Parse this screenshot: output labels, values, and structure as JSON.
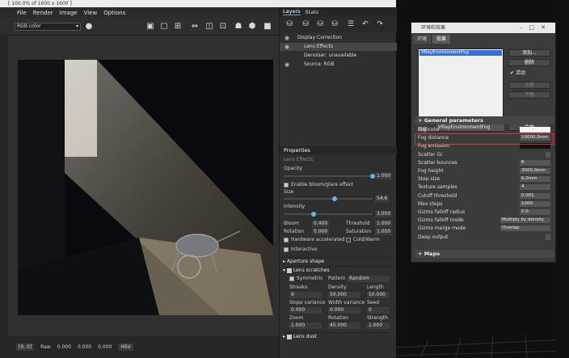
{
  "vfb": {
    "title": "[ 100.0% of 1600 x 1600 ]",
    "menu": [
      "File",
      "Render",
      "Image",
      "View",
      "Options"
    ],
    "channel_select": "RGB color",
    "status": {
      "coords": "[0, 0]",
      "fmt": "Raw",
      "values": [
        "0.000",
        "0.000",
        "0.000"
      ],
      "hsv": "HSV"
    }
  },
  "layers": {
    "tabs": [
      "Layers",
      "Stats"
    ],
    "tree": [
      {
        "label": "Display Correction",
        "indent": 0
      },
      {
        "label": "Lens Effects",
        "indent": 1,
        "selected": true
      },
      {
        "label": "Denoiser: unavailable",
        "indent": 1
      },
      {
        "label": "Source: RGB",
        "indent": 1
      }
    ]
  },
  "properties": {
    "header": "Properties",
    "subheader": "Lens Effects",
    "opacity_label": "Opacity",
    "opacity_value": "1.000",
    "enable_bloom_label": "Enable bloom/glare effect",
    "size_label": "Size",
    "size_value": "54.6",
    "intensity_label": "Intensity",
    "intensity_value": "3.000",
    "bloom_label": "Bloom",
    "bloom_value": "0.400",
    "threshold_label": "Threshold",
    "threshold_value": "1.000",
    "rotation_label": "Rotation",
    "rotation_value": "0.000",
    "saturation_label": "Saturation",
    "saturation_value": "1.000",
    "hw_accel_label": "Hardware accelerated",
    "coldwarm_label": "Cold/Warm",
    "interactive_label": "Interactive",
    "aperture_label": "Aperture shape",
    "lens_scratches_label": "Lens scratches",
    "symmetric_label": "Symmetric",
    "pattern_label": "Pattern",
    "pattern_value": "Random",
    "streaks_label": "Streaks",
    "streaks_value": "9",
    "density_label": "Density",
    "density_value": "50.000",
    "length_label": "Length",
    "length_value": "50.000",
    "slope_var_label": "Slope variance",
    "slope_var_value": "0.000",
    "width_var_label": "Width variance",
    "width_var_value": "0.000",
    "seed_label": "Seed",
    "seed_value": "0",
    "zoom_label": "Zoom",
    "zoom_value": "1.000",
    "rotation2_label": "Rotation",
    "rotation2_value": "45.000",
    "strength_label": "Strength",
    "strength_value": "1.000",
    "lens_dust_label": "Lens dust"
  },
  "env_dialog": {
    "title": "环境和效果",
    "tabs": [
      "环境",
      "效果"
    ],
    "atmo_items": [
      "VRayEnvironmentFog"
    ],
    "buttons": {
      "add": "添加...",
      "delete": "删除",
      "moveup": "上移",
      "movedown": "下移",
      "merge": "合并"
    },
    "active_label": "活动",
    "name_label": "名称:",
    "name_value": "VRayEnvironmentFog",
    "general_rollout": "General parameters",
    "maps_rollout": "Maps",
    "params": [
      {
        "label": "Fog color",
        "value": "",
        "swatch": "white"
      },
      {
        "label": "Fog distance",
        "value": "10000.0mm",
        "highlight": true
      },
      {
        "label": "Fog emission",
        "value": "",
        "swatch": "black"
      },
      {
        "label": "Scatter GI",
        "value": ""
      },
      {
        "label": "Scatter bounces",
        "value": "8"
      },
      {
        "label": "Fog height",
        "value": "3000.0mm"
      },
      {
        "label": "Step size",
        "value": "6.0mm"
      },
      {
        "label": "Texture samples",
        "value": "4"
      },
      {
        "label": "Cutoff threshold",
        "value": "0.001"
      },
      {
        "label": "Max steps",
        "value": "1000"
      },
      {
        "label": "Gizmo falloff radius",
        "value": "0.0"
      },
      {
        "label": "Gizmo falloff mode",
        "value": "Multiply by density",
        "wide": true
      },
      {
        "label": "Gizmo merge mode",
        "value": "Overlap",
        "wide": true
      },
      {
        "label": "Deep output",
        "value": ""
      }
    ]
  },
  "colors": {
    "accent_blue": "#5fb6e8",
    "highlight_red": "#d83434",
    "selection_blue": "#3a6fd0"
  }
}
